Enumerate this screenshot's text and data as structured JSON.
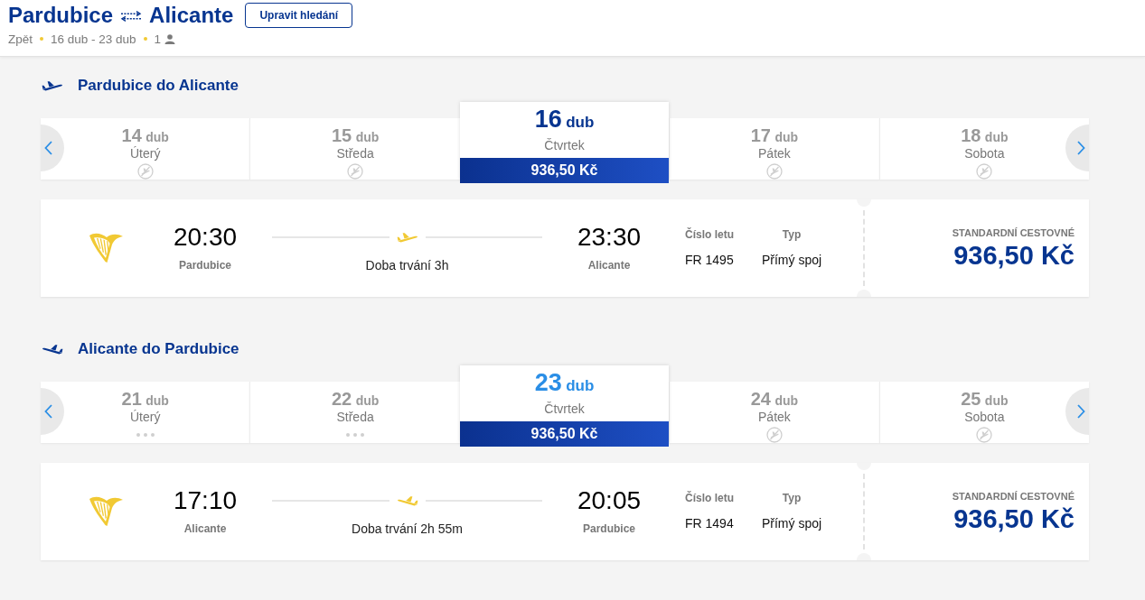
{
  "header": {
    "origin": "Pardubice",
    "destination": "Alicante",
    "edit_button": "Upravit hledání",
    "back_link": "Zpět",
    "dates": "16 dub - 23 dub",
    "passengers": "1"
  },
  "legs": [
    {
      "kind": "outbound",
      "title": "Pardubice do Alicante",
      "days": [
        {
          "day": "14",
          "month": "dub",
          "weekday": "Úterý",
          "selected": false,
          "kind": "no-flight"
        },
        {
          "day": "15",
          "month": "dub",
          "weekday": "Středa",
          "selected": false,
          "kind": "no-flight"
        },
        {
          "day": "16",
          "month": "dub",
          "weekday": "Čtvrtek",
          "selected": true,
          "kind": "price",
          "price": "936,50 Kč",
          "color": "#073590"
        },
        {
          "day": "17",
          "month": "dub",
          "weekday": "Pátek",
          "selected": false,
          "kind": "no-flight"
        },
        {
          "day": "18",
          "month": "dub",
          "weekday": "Sobota",
          "selected": false,
          "kind": "no-flight"
        }
      ],
      "flight": {
        "departure_time": "20:30",
        "departure_city": "Pardubice",
        "duration": "Doba trvání 3h",
        "arrival_time": "23:30",
        "arrival_city": "Alicante",
        "flight_number_label": "Číslo letu",
        "flight_number": "FR 1495",
        "type_label": "Typ",
        "type": "Přímý spoj",
        "fare_label": "STANDARDNÍ CESTOVNÉ",
        "price": "936,50 Kč"
      }
    },
    {
      "kind": "return",
      "title": "Alicante do Pardubice",
      "days": [
        {
          "day": "21",
          "month": "dub",
          "weekday": "Úterý",
          "selected": false,
          "kind": "loading"
        },
        {
          "day": "22",
          "month": "dub",
          "weekday": "Středa",
          "selected": false,
          "kind": "loading"
        },
        {
          "day": "23",
          "month": "dub",
          "weekday": "Čtvrtek",
          "selected": true,
          "kind": "price",
          "price": "936,50 Kč",
          "color": "#2a8ee6"
        },
        {
          "day": "24",
          "month": "dub",
          "weekday": "Pátek",
          "selected": false,
          "kind": "no-flight"
        },
        {
          "day": "25",
          "month": "dub",
          "weekday": "Sobota",
          "selected": false,
          "kind": "no-flight"
        }
      ],
      "flight": {
        "departure_time": "17:10",
        "departure_city": "Alicante",
        "duration": "Doba trvání 2h 55m",
        "arrival_time": "20:05",
        "arrival_city": "Pardubice",
        "flight_number_label": "Číslo letu",
        "flight_number": "FR 1494",
        "type_label": "Typ",
        "type": "Přímý spoj",
        "fare_label": "STANDARDNÍ CESTOVNÉ",
        "price": "936,50 Kč"
      }
    }
  ]
}
